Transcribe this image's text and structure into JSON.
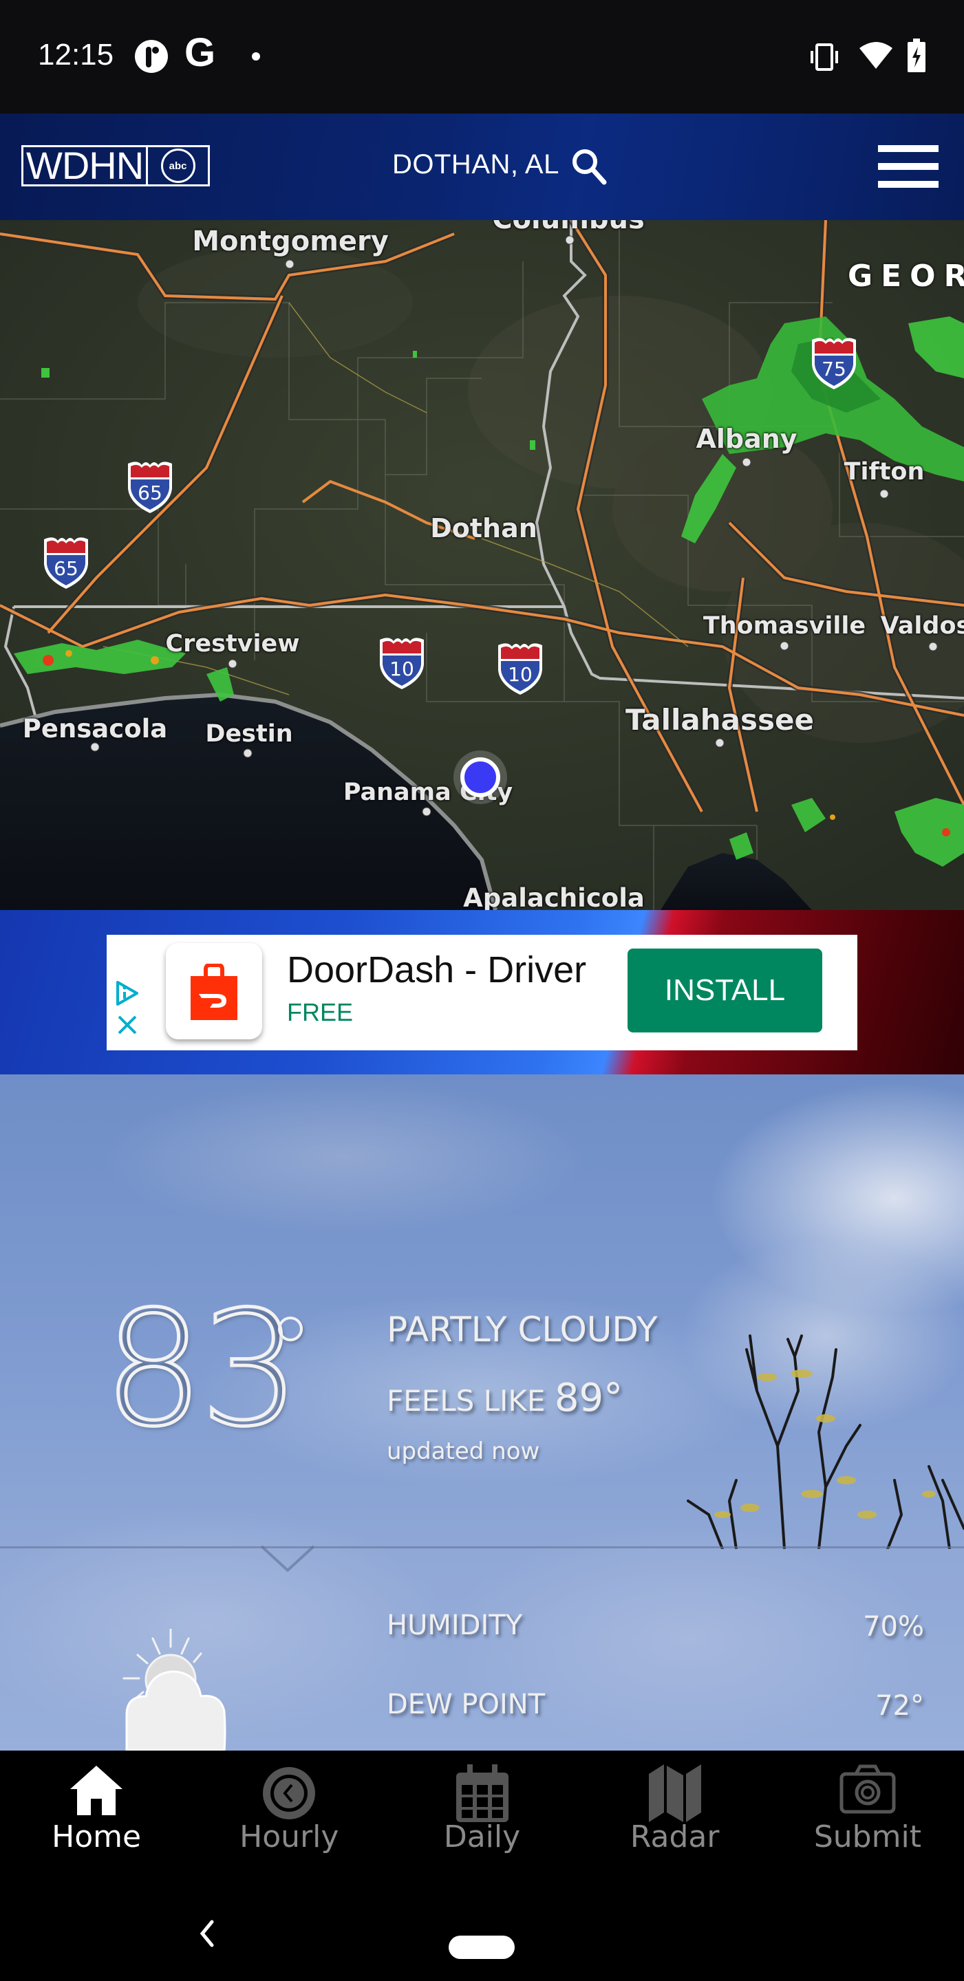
{
  "status_bar": {
    "time": "12:15",
    "notification_icons": [
      "p-notification-icon",
      "google-icon",
      "dot-icon"
    ],
    "system_icons": [
      "vibrate-icon",
      "wifi-icon",
      "battery-charging-icon"
    ]
  },
  "header": {
    "logo_text": "WDHN",
    "logo_network": "abc",
    "location": "DOTHAN, AL",
    "search_icon": "search-icon",
    "menu_icon": "hamburger-menu-icon"
  },
  "map": {
    "state_label": "GEORG",
    "cities": [
      {
        "name": "Montgomery"
      },
      {
        "name": "Columbus"
      },
      {
        "name": "Albany"
      },
      {
        "name": "Tifton"
      },
      {
        "name": "Dothan"
      },
      {
        "name": "Crestview"
      },
      {
        "name": "Thomasville"
      },
      {
        "name": "Valdos"
      },
      {
        "name": "Pensacola"
      },
      {
        "name": "Destin"
      },
      {
        "name": "Tallahassee"
      },
      {
        "name": "Panama City"
      },
      {
        "name": "Apalachicola"
      }
    ],
    "interstates": [
      "65",
      "65",
      "10",
      "10",
      "75"
    ],
    "current_location_marker": "location-marker"
  },
  "ad": {
    "app_name": "DoorDash - Driver",
    "price": "FREE",
    "cta": "INSTALL",
    "colors": {
      "cta": "#01875f",
      "app_icon": "#ff3008"
    }
  },
  "weather": {
    "temperature": "83",
    "condition": "PARTLY CLOUDY",
    "feels_like_label": "FEELS LIKE",
    "feels_like_value": "89°",
    "updated": "updated now",
    "icon": "partly-cloudy-icon",
    "stats": [
      {
        "label": "HUMIDITY",
        "value": "70%"
      },
      {
        "label": "DEW POINT",
        "value": "72°"
      }
    ]
  },
  "bottom_nav": {
    "items": [
      {
        "label": "Home",
        "icon": "home-icon",
        "active": true
      },
      {
        "label": "Hourly",
        "icon": "clock-icon",
        "active": false
      },
      {
        "label": "Daily",
        "icon": "calendar-icon",
        "active": false
      },
      {
        "label": "Radar",
        "icon": "map-icon",
        "active": false
      },
      {
        "label": "Submit",
        "icon": "camera-icon",
        "active": false
      }
    ]
  }
}
